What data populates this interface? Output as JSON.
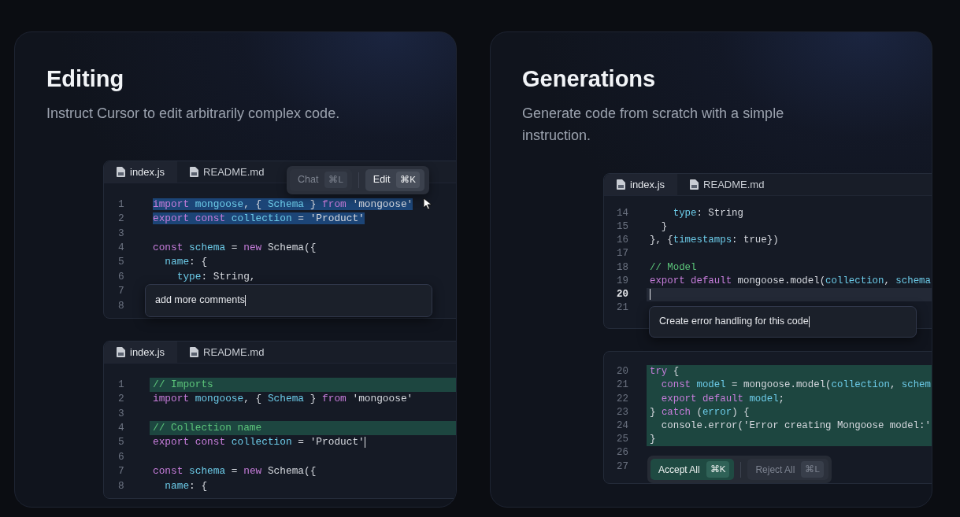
{
  "cards": [
    {
      "title": "Editing",
      "subtitle": "Instruct Cursor to edit arbitrarily complex code.",
      "editors": [
        {
          "tabs": [
            {
              "label": "index.js",
              "selected": true
            },
            {
              "label": "README.md",
              "selected": false
            }
          ],
          "toolbar": [
            {
              "label": "Chat",
              "shortcut": "⌘L",
              "selected": false
            },
            {
              "label": "Edit",
              "shortcut": "⌘K",
              "selected": true
            }
          ],
          "lines": [
            {
              "number": "1",
              "kind": "selection",
              "tokens": [
                {
                  "kind": "kw",
                  "text": "import "
                },
                {
                  "kind": "id",
                  "text": "mongoose"
                },
                {
                  "kind": "tx",
                  "text": ", { "
                },
                {
                  "kind": "id",
                  "text": "Schema"
                },
                {
                  "kind": "tx",
                  "text": " } "
                },
                {
                  "kind": "kw",
                  "text": "from "
                },
                {
                  "kind": "tx",
                  "text": "'mongoose'"
                }
              ]
            },
            {
              "number": "2",
              "kind": "selection",
              "tokens": [
                {
                  "kind": "kw",
                  "text": "export "
                },
                {
                  "kind": "kw",
                  "text": "const "
                },
                {
                  "kind": "id",
                  "text": "collection"
                },
                {
                  "kind": "tx",
                  "text": " = 'Product'"
                }
              ]
            },
            {
              "number": "3",
              "kind": "plain"
            },
            {
              "number": "4",
              "kind": "plain",
              "tokens": [
                {
                  "kind": "kw",
                  "text": "const "
                },
                {
                  "kind": "id",
                  "text": "schema"
                },
                {
                  "kind": "tx",
                  "text": " = "
                },
                {
                  "kind": "kw",
                  "text": "new "
                },
                {
                  "kind": "tx",
                  "text": "Schema({"
                }
              ]
            },
            {
              "number": "5",
              "kind": "plain",
              "tokens": [
                {
                  "kind": "id",
                  "text": "  name"
                },
                {
                  "kind": "tx",
                  "text": ": {"
                }
              ]
            },
            {
              "number": "6",
              "kind": "plain",
              "tokens": [
                {
                  "kind": "id",
                  "text": "    type"
                },
                {
                  "kind": "tx",
                  "text": ": String,"
                }
              ]
            },
            {
              "number": "7",
              "kind": "plain"
            },
            {
              "number": "8",
              "kind": "plain"
            }
          ],
          "prompt": {
            "text": "add more comments"
          }
        },
        {
          "tabs": [
            {
              "label": "index.js",
              "selected": true
            },
            {
              "label": "README.md",
              "selected": false
            }
          ],
          "lines": [
            {
              "number": "1",
              "kind": "added",
              "tokens": [
                {
                  "kind": "cm",
                  "text": "// Imports"
                }
              ]
            },
            {
              "number": "2",
              "kind": "plain",
              "tokens": [
                {
                  "kind": "kw",
                  "text": "import "
                },
                {
                  "kind": "id",
                  "text": "mongoose"
                },
                {
                  "kind": "tx",
                  "text": ", { "
                },
                {
                  "kind": "id",
                  "text": "Schema"
                },
                {
                  "kind": "tx",
                  "text": " } "
                },
                {
                  "kind": "kw",
                  "text": "from "
                },
                {
                  "kind": "tx",
                  "text": "'mongoose'"
                }
              ]
            },
            {
              "number": "3",
              "kind": "plain"
            },
            {
              "number": "4",
              "kind": "added",
              "tokens": [
                {
                  "kind": "cm",
                  "text": "// Collection name"
                }
              ]
            },
            {
              "number": "5",
              "kind": "plain",
              "caret": true,
              "tokens": [
                {
                  "kind": "kw",
                  "text": "export "
                },
                {
                  "kind": "kw",
                  "text": "const "
                },
                {
                  "kind": "id",
                  "text": "collection"
                },
                {
                  "kind": "tx",
                  "text": " = 'Product'"
                }
              ]
            },
            {
              "number": "6",
              "kind": "plain"
            },
            {
              "number": "7",
              "kind": "plain",
              "tokens": [
                {
                  "kind": "kw",
                  "text": "const "
                },
                {
                  "kind": "id",
                  "text": "schema"
                },
                {
                  "kind": "tx",
                  "text": " = "
                },
                {
                  "kind": "kw",
                  "text": "new "
                },
                {
                  "kind": "tx",
                  "text": "Schema({"
                }
              ]
            },
            {
              "number": "8",
              "kind": "plain",
              "tokens": [
                {
                  "kind": "id",
                  "text": "  name"
                },
                {
                  "kind": "tx",
                  "text": ": {"
                }
              ]
            }
          ]
        }
      ]
    },
    {
      "title": "Generations",
      "subtitle": "Generate code from scratch with a simple instruction.",
      "editors": [
        {
          "tabs": [
            {
              "label": "index.js",
              "selected": true
            },
            {
              "label": "README.md",
              "selected": false
            }
          ],
          "lines": [
            {
              "number": "14",
              "kind": "plain",
              "tokens": [
                {
                  "kind": "id",
                  "text": "    type"
                },
                {
                  "kind": "tx",
                  "text": ": String"
                }
              ]
            },
            {
              "number": "15",
              "kind": "plain",
              "tokens": [
                {
                  "kind": "tx",
                  "text": "  }"
                }
              ]
            },
            {
              "number": "16",
              "kind": "plain",
              "tokens": [
                {
                  "kind": "tx",
                  "text": "}, {"
                },
                {
                  "kind": "id",
                  "text": "timestamps"
                },
                {
                  "kind": "tx",
                  "text": ": true})"
                }
              ]
            },
            {
              "number": "17",
              "kind": "plain"
            },
            {
              "number": "18",
              "kind": "plain",
              "tokens": [
                {
                  "kind": "cm",
                  "text": "// Model"
                }
              ]
            },
            {
              "number": "19",
              "kind": "plain",
              "tokens": [
                {
                  "kind": "kw",
                  "text": "export "
                },
                {
                  "kind": "kw",
                  "text": "default "
                },
                {
                  "kind": "tx",
                  "text": "mongoose.model("
                },
                {
                  "kind": "id",
                  "text": "collection"
                },
                {
                  "kind": "tx",
                  "text": ", "
                },
                {
                  "kind": "id",
                  "text": "schema"
                }
              ]
            },
            {
              "number": "20",
              "kind": "current",
              "caret": true
            },
            {
              "number": "21",
              "kind": "plain"
            }
          ],
          "prompt": {
            "text": "Create error handling for this code"
          }
        },
        {
          "lines": [
            {
              "number": "20",
              "kind": "added",
              "tokens": [
                {
                  "kind": "kw",
                  "text": "try "
                },
                {
                  "kind": "tx",
                  "text": "{"
                }
              ]
            },
            {
              "number": "21",
              "kind": "added",
              "tokens": [
                {
                  "kind": "kw",
                  "text": "  const "
                },
                {
                  "kind": "id",
                  "text": "model"
                },
                {
                  "kind": "tx",
                  "text": " = mongoose.model("
                },
                {
                  "kind": "id",
                  "text": "collection"
                },
                {
                  "kind": "tx",
                  "text": ", "
                },
                {
                  "kind": "id",
                  "text": "schem"
                }
              ]
            },
            {
              "number": "22",
              "kind": "added",
              "tokens": [
                {
                  "kind": "kw",
                  "text": "  export "
                },
                {
                  "kind": "kw",
                  "text": "default "
                },
                {
                  "kind": "id",
                  "text": "model"
                },
                {
                  "kind": "tx",
                  "text": ";"
                }
              ]
            },
            {
              "number": "23",
              "kind": "added",
              "tokens": [
                {
                  "kind": "tx",
                  "text": "} "
                },
                {
                  "kind": "kw",
                  "text": "catch "
                },
                {
                  "kind": "tx",
                  "text": "("
                },
                {
                  "kind": "id",
                  "text": "error"
                },
                {
                  "kind": "tx",
                  "text": ") {"
                }
              ]
            },
            {
              "number": "24",
              "kind": "added",
              "tokens": [
                {
                  "kind": "tx",
                  "text": "  console.error('Error creating Mongoose model:'"
                }
              ]
            },
            {
              "number": "25",
              "kind": "added",
              "tokens": [
                {
                  "kind": "tx",
                  "text": "}"
                }
              ]
            },
            {
              "number": "26",
              "kind": "plain"
            },
            {
              "number": "27",
              "kind": "plain"
            }
          ],
          "actions": [
            {
              "label": "Accept All",
              "shortcut": "⌘K",
              "kind": "primary"
            },
            {
              "label": "Reject All",
              "shortcut": "⌘L",
              "kind": "secondary"
            }
          ]
        }
      ]
    }
  ]
}
